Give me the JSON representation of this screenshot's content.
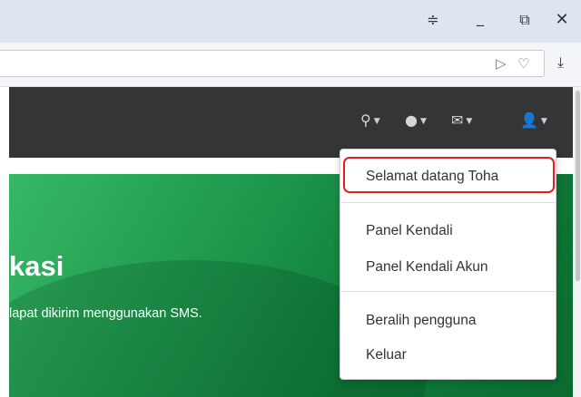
{
  "window": {
    "menu_icon": "≑",
    "minimize_icon": "_",
    "restore_icon": "⧉",
    "close_icon": "✕"
  },
  "toolbar": {
    "send_icon": "▷",
    "heart_icon": "♡",
    "download_icon": "⤓"
  },
  "navbar": {
    "search_icon": "⚲",
    "chat_icon": "●",
    "mail_icon": "✉",
    "user_icon": "👤",
    "caret": "▼",
    "background": "#333537"
  },
  "hero": {
    "title": "kasi",
    "subtitle": "lapat dikirim menggunakan SMS.",
    "accent": "#1f9a4e"
  },
  "dropdown": {
    "welcome": "Selamat datang Toha",
    "panel": "Panel Kendali",
    "panel_akun": "Panel Kendali Akun",
    "switch_user": "Beralih pengguna",
    "logout": "Keluar",
    "highlight_color": "#e0201f"
  }
}
